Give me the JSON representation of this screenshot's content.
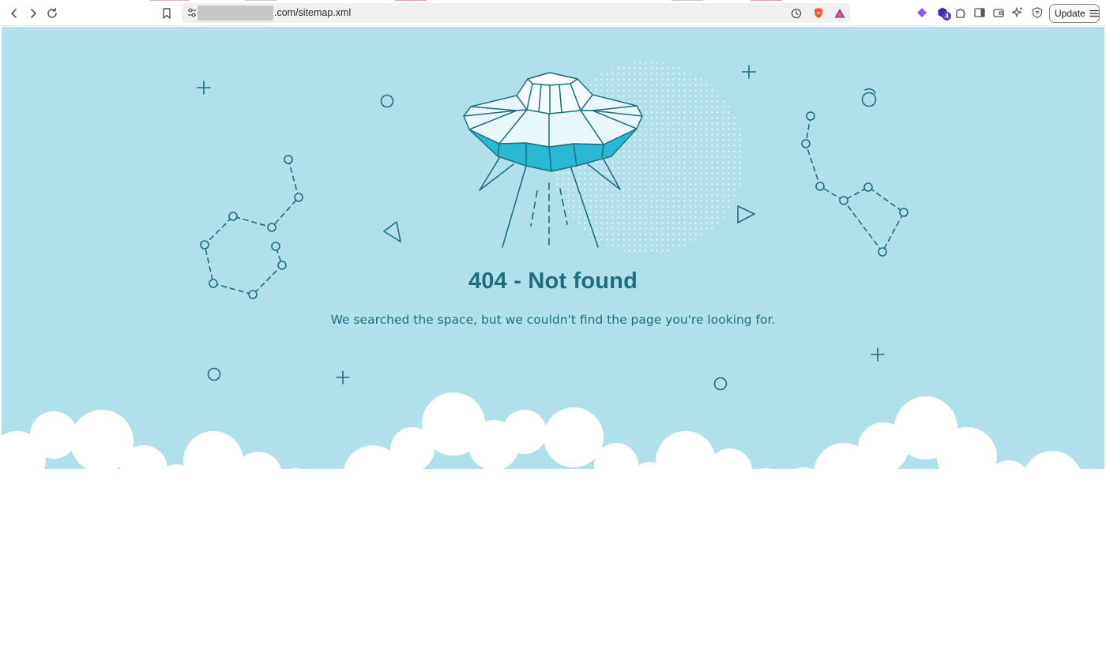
{
  "browser": {
    "url_suffix": ".com/sitemap.xml",
    "update_label": "Update",
    "extension_badge": "4",
    "colors": {
      "brave_orange": "#fb542b",
      "rewards_purple": "#6a3bd6",
      "toolbar_icon": "#555555"
    }
  },
  "page": {
    "heading": "404 - Not found",
    "message": "We searched the space, but we couldn't find the page you're looking for.",
    "colors": {
      "sky": "#b0e0ea",
      "ink": "#1c6f7d",
      "saucer_accent": "#28b8d4",
      "cloud": "#ffffff"
    }
  }
}
